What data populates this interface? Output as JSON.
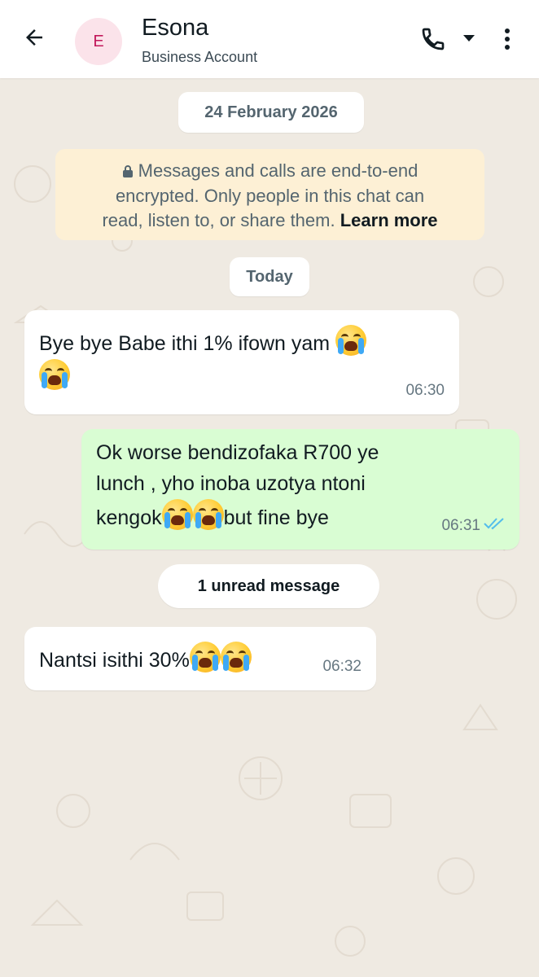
{
  "header": {
    "contact_name": "Esona",
    "contact_subtitle": "Business Account",
    "avatar_initial": "E",
    "icons": [
      "back-arrow-icon",
      "phone-icon",
      "caret-down-icon",
      "more-vert-icon"
    ]
  },
  "chat": {
    "date_divider": "24 February 2026",
    "encryption_notice": {
      "line1": "Messages and calls are end-to-end",
      "line2": "encrypted. Only people in this chat can",
      "line3": "read, listen to, or share them.",
      "learn_more": "Learn more"
    },
    "today_divider": "Today",
    "unread_divider": "1 unread message",
    "messages": [
      {
        "direction": "incoming",
        "text_a": "Bye bye Babe ithi 1% ifown yam",
        "time": "06:30"
      },
      {
        "direction": "outgoing",
        "line1": "Ok worse bendizofaka R700 ye",
        "line2": "lunch , yho inoba uzotya ntoni",
        "line3a": "kengok",
        "line3b": "but fine bye",
        "time": "06:31",
        "status": "read-double-tick-icon"
      },
      {
        "direction": "incoming",
        "text_a": "Nantsi isithi 30%",
        "time": "06:32"
      }
    ],
    "emoji": "loudly-crying-face-emoji"
  },
  "colors": {
    "background": "#efeae2",
    "incoming_bubble": "#ffffff",
    "outgoing_bubble": "#d9fdd3",
    "encryption_bg": "#fdf0d5",
    "read_tick": "#53bdeb",
    "avatar_bg": "#fbe3ea",
    "avatar_text": "#c2185b"
  }
}
